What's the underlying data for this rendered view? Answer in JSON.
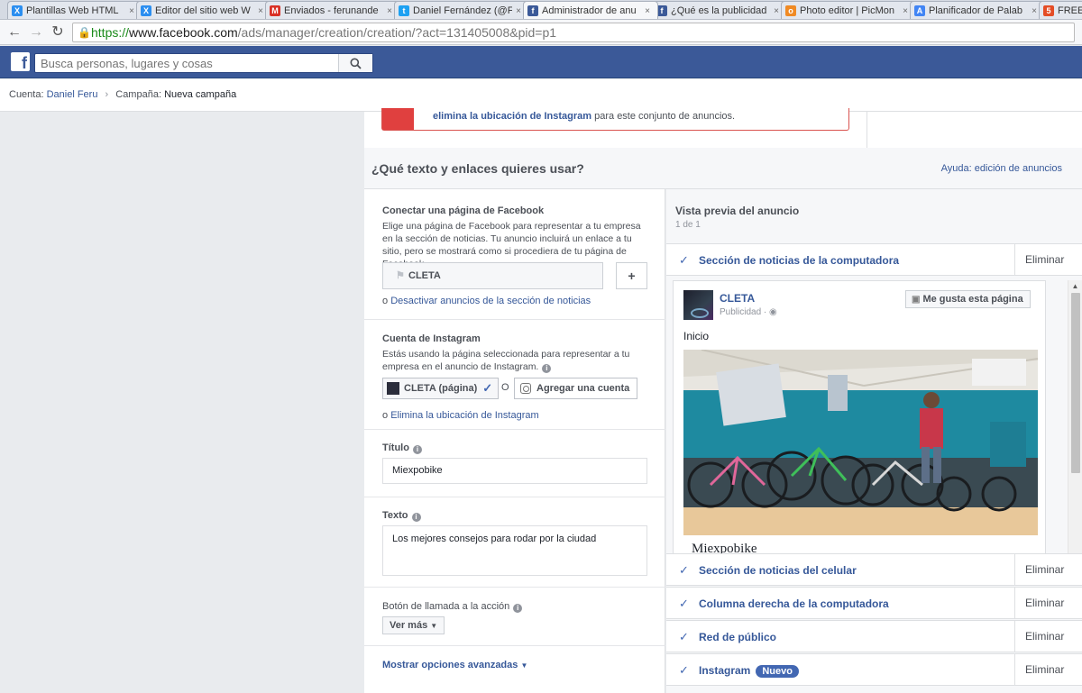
{
  "browser": {
    "tabs": [
      {
        "title": "Plantillas Web HTML",
        "icon": "wix-icon",
        "color": "#2b8ef0",
        "glyph": "X"
      },
      {
        "title": "Editor del sitio web W",
        "icon": "wix-icon",
        "color": "#2b8ef0",
        "glyph": "X"
      },
      {
        "title": "Enviados - ferunande",
        "icon": "gmail-icon",
        "color": "#d93025",
        "glyph": "M"
      },
      {
        "title": "Daniel Fernández (@F",
        "icon": "twitter-icon",
        "color": "#1da1f2",
        "glyph": "t"
      },
      {
        "title": "Administrador de anu",
        "icon": "facebook-icon",
        "color": "#3b5998",
        "glyph": "f"
      },
      {
        "title": "¿Qué es la publicidad",
        "icon": "facebook-icon",
        "color": "#3b5998",
        "glyph": "f"
      },
      {
        "title": "Photo editor | PicMon",
        "icon": "picmonkey-icon",
        "color": "#f08a24",
        "glyph": "o"
      },
      {
        "title": "Planificador de Palab",
        "icon": "adwords-icon",
        "color": "#4285f4",
        "glyph": "A"
      },
      {
        "title": "FREE Ba",
        "icon": "html5-icon",
        "color": "#e44d26",
        "glyph": "5"
      }
    ],
    "active_tab": 4,
    "url": {
      "scheme": "https://",
      "host": "www.facebook.com",
      "path": "/ads/manager/creation/creation/?act=131405008&pid=p1"
    }
  },
  "fb_header": {
    "search_placeholder": "Busca personas, lugares y cosas"
  },
  "breadcrumb": {
    "account_label": "Cuenta:",
    "account_value": "Daniel Feru",
    "campaign_label": "Campaña:",
    "campaign_value": "Nueva campaña"
  },
  "alert": {
    "link_text": "elimina la ubicación de Instagram",
    "rest_text": " para este conjunto de anuncios."
  },
  "section": {
    "title": "¿Qué texto y enlaces quieres usar?",
    "help_link": "Ayuda: edición de anuncios"
  },
  "form": {
    "fb_page": {
      "label": "Conectar una página de Facebook",
      "description": "Elige una página de Facebook para representar a tu empresa en la sección de noticias. Tu anuncio incluirá un enlace a tu sitio, pero se mostrará como si procediera de tu página de Facebook.",
      "selected_page": "CLETA",
      "add_button": "+",
      "link_prefix": "o ",
      "link_text": "Desactivar anuncios de la sección de noticias"
    },
    "instagram": {
      "label": "Cuenta de Instagram",
      "description": "Estás usando la página seleccionada para representar a tu empresa en el anuncio de Instagram.",
      "selected": "CLETA (página)",
      "separator": "O",
      "add_account": "Agregar una cuenta",
      "link_prefix": "o ",
      "link_text": "Elimina la ubicación de Instagram"
    },
    "headline": {
      "label": "Título",
      "value": "Miexpobike"
    },
    "text": {
      "label": "Texto",
      "value": "Los mejores consejos para rodar por la ciudad"
    },
    "cta": {
      "label": "Botón de llamada a la acción",
      "selected": "Ver más"
    },
    "advanced_link": "Mostrar opciones avanzadas"
  },
  "preview": {
    "title": "Vista previa del anuncio",
    "count": "1 de 1",
    "remove_label": "Eliminar",
    "placements": [
      {
        "name": "Sección de noticias de la computadora",
        "badge": ""
      },
      {
        "name": "Sección de noticias del celular",
        "badge": ""
      },
      {
        "name": "Columna derecha de la computadora",
        "badge": ""
      },
      {
        "name": "Red de público",
        "badge": ""
      },
      {
        "name": "Instagram",
        "badge": "Nuevo"
      }
    ],
    "ad": {
      "page_name": "CLETA",
      "sponsored": "Publicidad ·",
      "like_button": "Me gusta esta página",
      "body_text": "Inicio",
      "headline": "Miexpobike"
    }
  }
}
